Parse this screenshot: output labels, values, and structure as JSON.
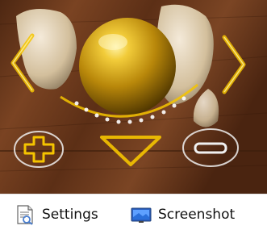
{
  "colors": {
    "overlay_gold": "#f5c400",
    "overlay_white": "#eeeeee",
    "wood_dark": "#5a2f15",
    "wood_light": "#7e4623",
    "status_bg": "#ffffff"
  },
  "viewport": {
    "overlay_controls": [
      {
        "name": "rotate-left-arrow",
        "icon": "chevron-left-icon"
      },
      {
        "name": "rotate-right-arrow",
        "icon": "chevron-right-icon"
      },
      {
        "name": "move-down-arrow",
        "icon": "triangle-down-icon"
      },
      {
        "name": "zoom-in",
        "icon": "plus-icon"
      },
      {
        "name": "zoom-out",
        "icon": "minus-icon"
      }
    ]
  },
  "statusbar": {
    "settings_label": "Settings",
    "settings_icon": "settings-document-icon",
    "screenshot_label": "Screenshot",
    "screenshot_icon": "screenshot-monitor-icon"
  }
}
